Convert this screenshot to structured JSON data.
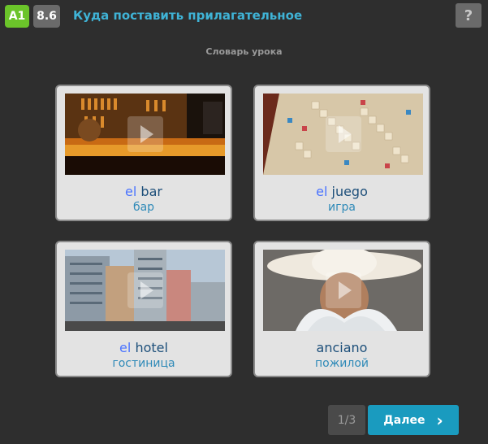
{
  "header": {
    "level_badge": "A1",
    "score_badge": "8.6",
    "title": "Куда поставить прилагательное",
    "help_label": "?"
  },
  "section_label": "Словарь урока",
  "cards": [
    {
      "article": "el",
      "word": "bar",
      "translation": "бар",
      "image": "bar-interior-photo"
    },
    {
      "article": "el",
      "word": "juego",
      "translation": "игра",
      "image": "scrabble-board-photo"
    },
    {
      "article": "el",
      "word": "hotel",
      "translation": "гостиница",
      "image": "city-hotels-photo"
    },
    {
      "article": "",
      "word": "anciano",
      "translation": "пожилой",
      "image": "old-man-cowboy-hat-photo"
    }
  ],
  "footer": {
    "pager": "1/3",
    "next_label": "Далее",
    "next_icon": "chevron-right-icon"
  },
  "colors": {
    "background": "#2e2e2e",
    "level_badge": "#6bc42a",
    "accent": "#1a9bbf",
    "title": "#3fb3d6"
  }
}
